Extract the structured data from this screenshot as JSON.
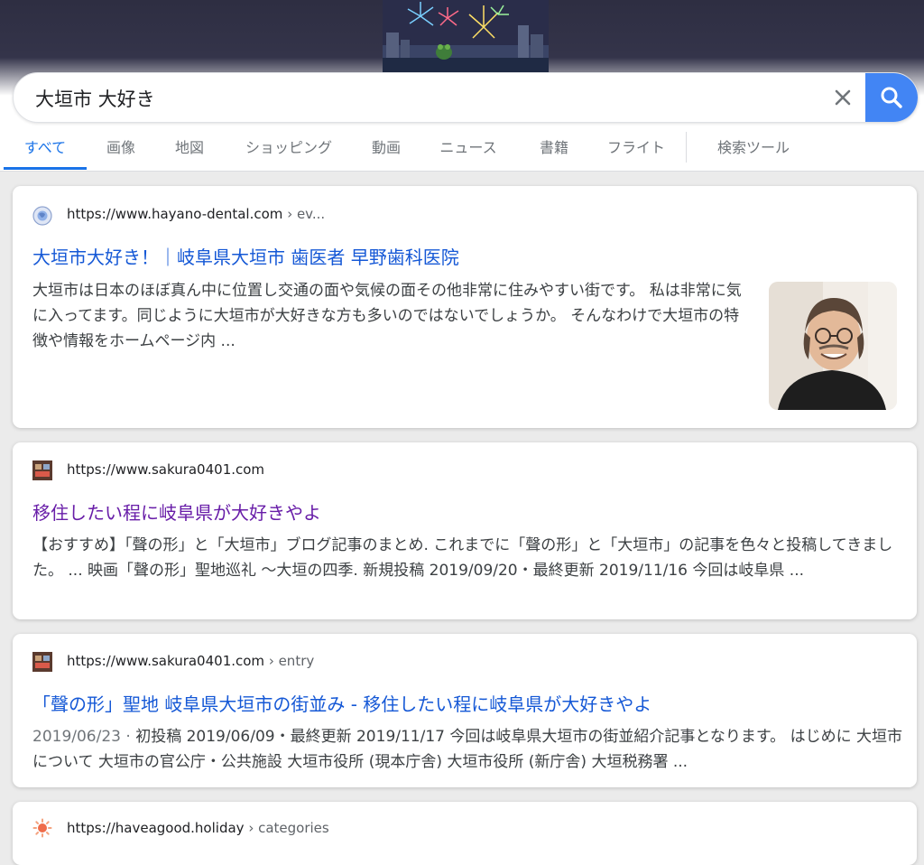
{
  "search": {
    "query": "大垣市 大好き"
  },
  "tabs": [
    {
      "label": "すべて"
    },
    {
      "label": "画像"
    },
    {
      "label": "地図"
    },
    {
      "label": "ショッピング"
    },
    {
      "label": "動画"
    },
    {
      "label": "ニュース"
    },
    {
      "label": "書籍"
    },
    {
      "label": "フライト"
    },
    {
      "label": "検索ツール"
    }
  ],
  "colors": {
    "accent": "#1a73e8",
    "search_button": "#4285f4",
    "link": "#1558d6",
    "visited_link": "#681da8"
  },
  "results": [
    {
      "url": "https://www.hayano-dental.com",
      "crumb": " › ev...",
      "title": "大垣市大好き！｜岐阜県大垣市 歯医者 早野歯科医院",
      "snippet": "大垣市は日本のほぼ真ん中に位置し交通の面や気候の面その他非常に住みやすい街です。 私は非常に気に入ってます。同じように大垣市が大好きな方も多いのではないでしょうか。 そんなわけで大垣市の特徴や情報をホームページ内 ...",
      "favicon": "globe-icon",
      "has_thumbnail": true
    },
    {
      "url": "https://www.sakura0401.com",
      "crumb": "",
      "title": "移住したい程に岐阜県が大好きやよ",
      "snippet": "【おすすめ】「聲の形」と「大垣市」ブログ記事のまとめ. これまでに「聲の形」と「大垣市」の記事を色々と投稿してきました。 ... 映画「聲の形」聖地巡礼 〜大垣の四季. 新規投稿 2019/09/20・最終更新 2019/11/16 今回は岐阜県 ...",
      "favicon": "site-thumbnail-icon",
      "visited": true
    },
    {
      "url": "https://www.sakura0401.com",
      "crumb": " › entry",
      "title": "「聲の形」聖地 岐阜県大垣市の街並み - 移住したい程に岐阜県が大好きやよ",
      "date": "2019/06/23 · ",
      "snippet": "初投稿 2019/06/09・最終更新 2019/11/17 今回は岐阜県大垣市の街並紹介記事となります。 はじめに 大垣市について 大垣市の官公庁・公共施設 大垣市役所 (現本庁舎) 大垣市役所 (新庁舎) 大垣税務署 ...",
      "favicon": "site-thumbnail-icon"
    },
    {
      "url": "https://haveagood.holiday",
      "crumb": " › categories",
      "favicon": "sun-icon"
    }
  ]
}
